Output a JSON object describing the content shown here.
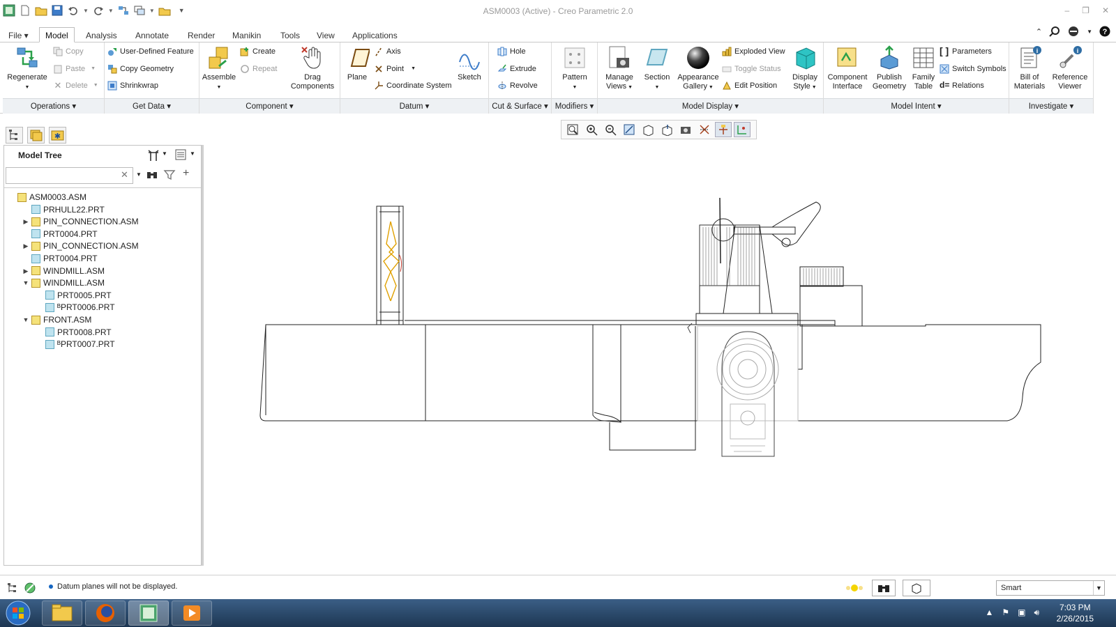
{
  "window": {
    "title": "ASM0003 (Active) - Creo Parametric 2.0"
  },
  "menu": {
    "tabs": [
      "File ▾",
      "Model",
      "Analysis",
      "Annotate",
      "Render",
      "Manikin",
      "Tools",
      "View",
      "Applications"
    ],
    "active": "Model"
  },
  "ribbon": {
    "groups": {
      "operations": "Operations ▾",
      "get_data": "Get Data ▾",
      "component": "Component ▾",
      "datum": "Datum ▾",
      "cut_surface": "Cut & Surface ▾",
      "modifiers": "Modifiers ▾",
      "model_display": "Model Display ▾",
      "model_intent": "Model Intent ▾",
      "investigate": "Investigate ▾"
    },
    "regenerate": "Regenerate",
    "copy": "Copy",
    "paste": "Paste",
    "delete": "Delete",
    "user_defined_feature": "User-Defined Feature",
    "copy_geometry": "Copy Geometry",
    "shrinkwrap": "Shrinkwrap",
    "assemble": "Assemble",
    "create": "Create",
    "repeat": "Repeat",
    "drag_components_1": "Drag",
    "drag_components_2": "Components",
    "plane": "Plane",
    "axis": "Axis",
    "point": "Point",
    "coordinate_system": "Coordinate System",
    "sketch": "Sketch",
    "hole": "Hole",
    "extrude": "Extrude",
    "revolve": "Revolve",
    "pattern": "Pattern",
    "manage_views_1": "Manage",
    "manage_views_2": "Views",
    "section": "Section",
    "appearance_gallery_1": "Appearance",
    "appearance_gallery_2": "Gallery",
    "exploded_view": "Exploded View",
    "toggle_status": "Toggle Status",
    "edit_position": "Edit Position",
    "display_style_1": "Display",
    "display_style_2": "Style",
    "component_interface_1": "Component",
    "component_interface_2": "Interface",
    "publish_geometry_1": "Publish",
    "publish_geometry_2": "Geometry",
    "family_table_1": "Family",
    "family_table_2": "Table",
    "parameters": "Parameters",
    "switch_symbols": "Switch Symbols",
    "relations": "Relations",
    "bill_of_materials_1": "Bill of",
    "bill_of_materials_2": "Materials",
    "reference_viewer_1": "Reference",
    "reference_viewer_2": "Viewer"
  },
  "model_tree": {
    "title": "Model Tree",
    "search_value": "",
    "items": [
      {
        "label": "ASM0003.ASM",
        "type": "asm",
        "level": 0,
        "expander": ""
      },
      {
        "label": "PRHULL22.PRT",
        "type": "prt",
        "level": 1,
        "expander": ""
      },
      {
        "label": "PIN_CONNECTION.ASM",
        "type": "asm",
        "level": 1,
        "expander": "▶"
      },
      {
        "label": "PRT0004.PRT",
        "type": "prt",
        "level": 1,
        "expander": ""
      },
      {
        "label": "PIN_CONNECTION.ASM",
        "type": "asm",
        "level": 1,
        "expander": "▶"
      },
      {
        "label": "PRT0004.PRT",
        "type": "prt",
        "level": 1,
        "expander": ""
      },
      {
        "label": "WINDMILL.ASM",
        "type": "asm",
        "level": 1,
        "expander": "▶"
      },
      {
        "label": "WINDMILL.ASM",
        "type": "asm",
        "level": 1,
        "expander": "▼"
      },
      {
        "label": "PRT0005.PRT",
        "type": "prt",
        "level": 2,
        "expander": ""
      },
      {
        "label": "ᴮPRT0006.PRT",
        "type": "prt",
        "level": 2,
        "expander": ""
      },
      {
        "label": "FRONT.ASM",
        "type": "asm",
        "level": 1,
        "expander": "▼"
      },
      {
        "label": "PRT0008.PRT",
        "type": "prt",
        "level": 2,
        "expander": ""
      },
      {
        "label": "ᴮPRT0007.PRT",
        "type": "prt",
        "level": 2,
        "expander": ""
      }
    ]
  },
  "status": {
    "message": "Datum planes will not be displayed.",
    "filter": "Smart"
  },
  "taskbar": {
    "time": "7:03 PM",
    "date": "2/26/2015"
  }
}
